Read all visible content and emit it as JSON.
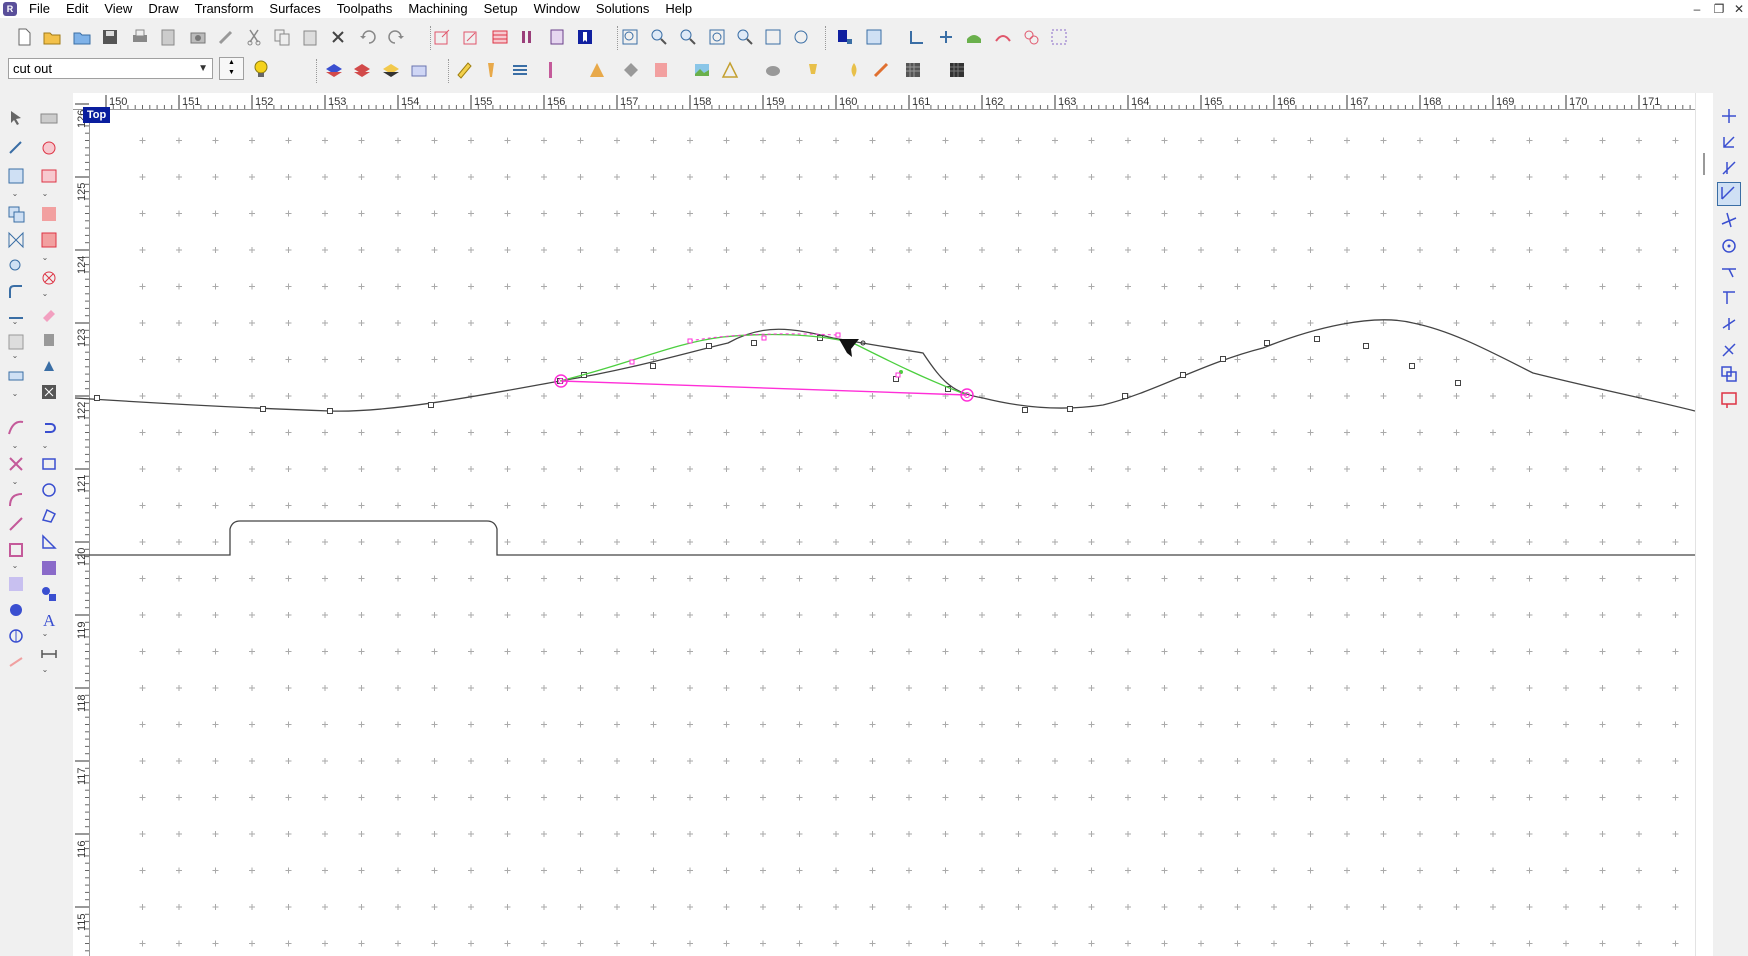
{
  "menu": {
    "logo": "R",
    "items": [
      "File",
      "Edit",
      "View",
      "Draw",
      "Transform",
      "Surfaces",
      "Toolpaths",
      "Machining",
      "Setup",
      "Window",
      "Solutions",
      "Help"
    ]
  },
  "window_controls": {
    "minimize": "–",
    "restore": "❐",
    "close": "✕"
  },
  "layer_selector": {
    "value": "cut out"
  },
  "viewport": {
    "view_label": "Top",
    "x_axis_labels": [
      "150",
      "151",
      "152",
      "153",
      "154",
      "155",
      "156",
      "157",
      "158",
      "159",
      "160",
      "161",
      "162",
      "163",
      "164",
      "165",
      "166",
      "167",
      "168",
      "169",
      "170",
      "171"
    ],
    "y_axis_labels": [
      "126",
      "125",
      "124",
      "123",
      "122",
      "121",
      "120",
      "119",
      "118",
      "117",
      "116",
      "115"
    ]
  },
  "colors": {
    "curve": "#444444",
    "selection": "#ff2fd8",
    "preview": "#4ccf3f",
    "view_tag": "#0a1e9e",
    "grid": "#aaaaaa"
  }
}
